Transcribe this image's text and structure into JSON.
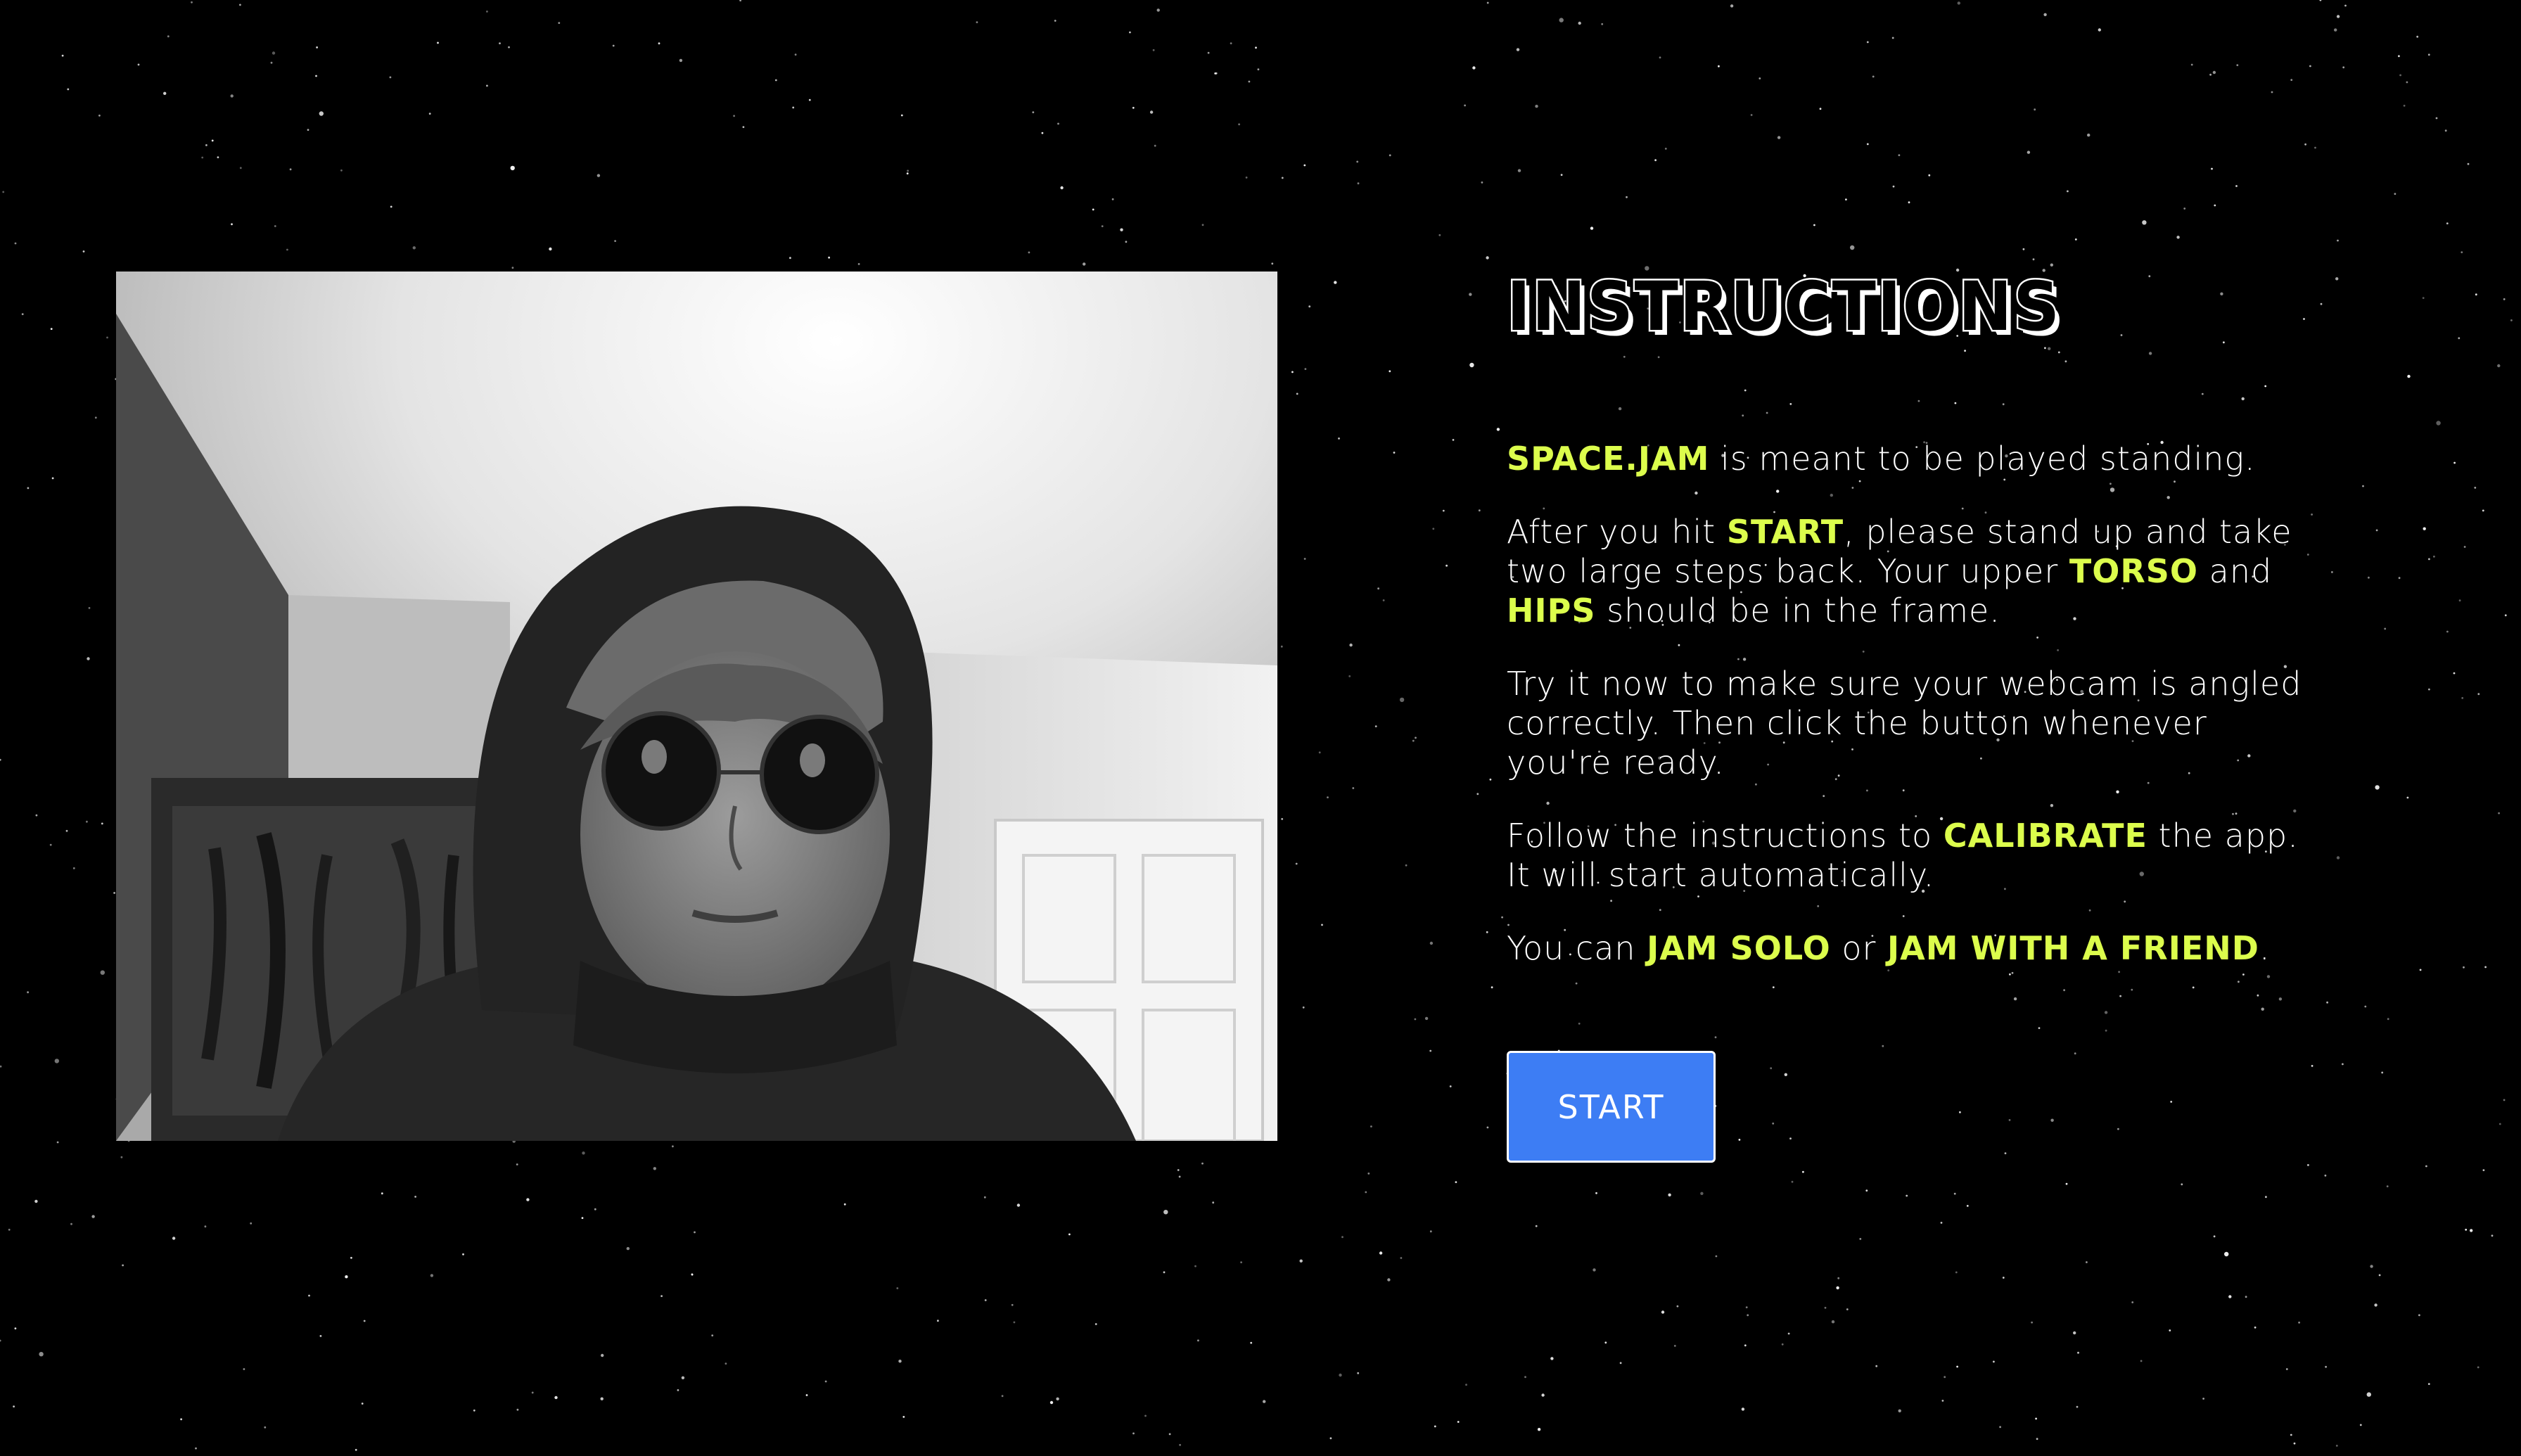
{
  "page": {
    "background_color": "#000000",
    "accent_color": "#dcfd4c",
    "button_color": "#3d7df4"
  },
  "webcam": {
    "icon": "webcam-feed-image",
    "description_visible": false
  },
  "instructions": {
    "title": "INSTRUCTIONS",
    "p1": {
      "hl1": "SPACE.JAM",
      "t1": " is meant to be played standing."
    },
    "p2": {
      "t1": "After you hit ",
      "hl1": "START",
      "t2": ", please stand up and take two large steps back. Your upper ",
      "hl2": "TORSO",
      "t3": " and ",
      "hl3": "HIPS",
      "t4": " should be in the frame."
    },
    "p3": {
      "t1": "Try it now to make sure your webcam is angled correctly. Then click the button whenever you're ready."
    },
    "p4": {
      "t1": "Follow the instructions to ",
      "hl1": "CALIBRATE",
      "t2": " the app. It will start automatically."
    },
    "p5": {
      "t1": "You can ",
      "hl1": "JAM SOLO",
      "t2": " or ",
      "hl2": "JAM WITH A FRIEND",
      "t3": "."
    }
  },
  "start_button": {
    "label": "START"
  }
}
